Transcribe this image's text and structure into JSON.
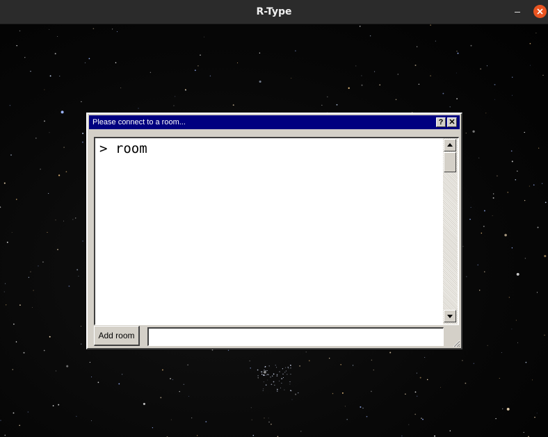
{
  "window": {
    "title": "R-Type",
    "minimize_icon": "minimize-icon",
    "close_icon": "close-icon",
    "close_color": "#e95420"
  },
  "dialog": {
    "title": "Please connect to a room...",
    "help_label": "?",
    "close_label": "✕",
    "title_bar_color": "#000080",
    "log_lines": [
      "> room"
    ],
    "add_room_label": "Add room",
    "room_input_value": "",
    "room_input_placeholder": ""
  }
}
